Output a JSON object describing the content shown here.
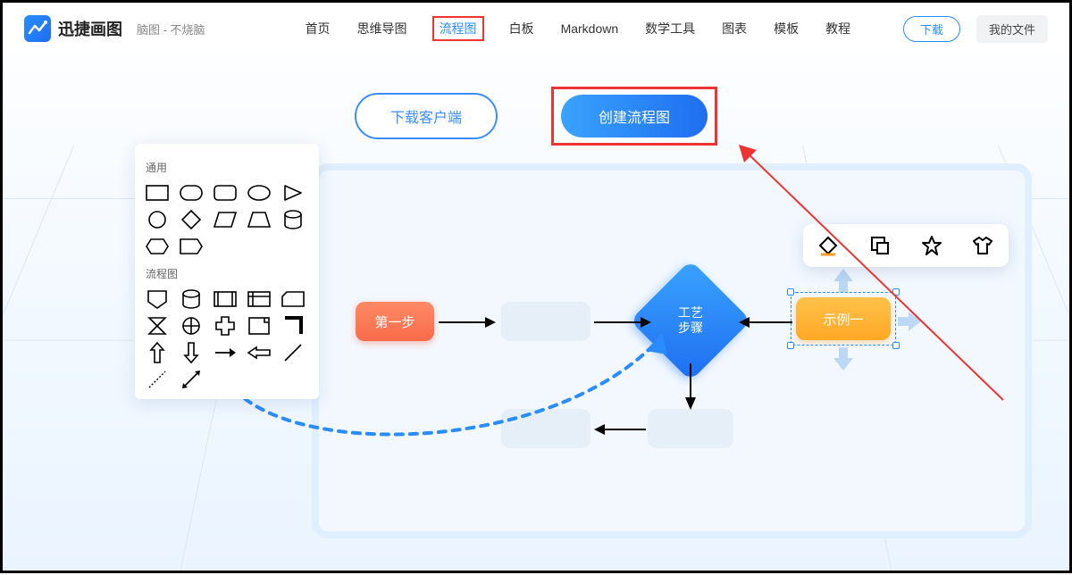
{
  "header": {
    "brand": "迅捷画图",
    "subtitle": "脑图 - 不烧脑",
    "nav": {
      "home": "首页",
      "mindmap": "思维导图",
      "flowchart": "流程图",
      "whiteboard": "白板",
      "markdown": "Markdown",
      "math": "数学工具",
      "chart": "图表",
      "template": "模板",
      "tutorial": "教程"
    },
    "download": "下载",
    "myfiles": "我的文件"
  },
  "hero": {
    "download_client": "下载客户端",
    "create_flowchart": "创建流程图"
  },
  "palette": {
    "group_general": "通用",
    "group_flowchart": "流程图"
  },
  "toolbar": {
    "fill": "fill-icon",
    "arrange": "arrange-icon",
    "star": "star-icon",
    "shirt": "shirt-icon"
  },
  "nodes": {
    "step1": "第一步",
    "process": "工艺\n步骤",
    "example": "示例一"
  }
}
